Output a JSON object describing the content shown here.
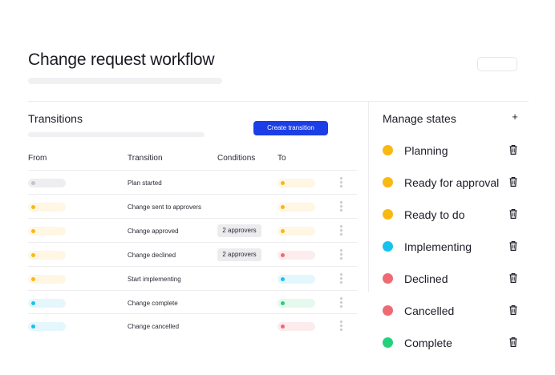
{
  "page": {
    "title": "Change request workflow"
  },
  "transitions": {
    "title": "Transitions",
    "create_button": "Create transition",
    "columns": {
      "from": "From",
      "transition": "Transition",
      "conditions": "Conditions",
      "to": "To"
    },
    "rows": [
      {
        "from_color": "grey",
        "transition": "Plan started",
        "conditions": "",
        "to_color": "yellow"
      },
      {
        "from_color": "yellow",
        "transition": "Change sent to approvers",
        "conditions": "",
        "to_color": "yellow"
      },
      {
        "from_color": "yellow",
        "transition": "Change approved",
        "conditions": "2 approvers",
        "to_color": "yellow"
      },
      {
        "from_color": "yellow",
        "transition": "Change declined",
        "conditions": "2 approvers",
        "to_color": "red"
      },
      {
        "from_color": "yellow",
        "transition": "Start implementing",
        "conditions": "",
        "to_color": "blue"
      },
      {
        "from_color": "blue",
        "transition": "Change complete",
        "conditions": "",
        "to_color": "green"
      },
      {
        "from_color": "blue",
        "transition": "Change cancelled",
        "conditions": "",
        "to_color": "red"
      }
    ]
  },
  "manage_states": {
    "title": "Manage states",
    "add_icon": "plus-icon",
    "states": [
      {
        "label": "Planning",
        "color": "#f9b812"
      },
      {
        "label": "Ready for approval",
        "color": "#f9b812"
      },
      {
        "label": "Ready to do",
        "color": "#f9b812"
      },
      {
        "label": "Implementing",
        "color": "#17c1ee"
      },
      {
        "label": "Declined",
        "color": "#ef6a71"
      },
      {
        "label": "Cancelled",
        "color": "#ef6a71"
      },
      {
        "label": "Complete",
        "color": "#23d17d"
      }
    ],
    "delete_icon": "trash-icon"
  },
  "colors": {
    "accent": "#1b3ee6",
    "yellow": "#f9b812",
    "blue": "#17c1ee",
    "red": "#ef6a71",
    "green": "#23d17d",
    "grey": "#c4c4c9"
  }
}
